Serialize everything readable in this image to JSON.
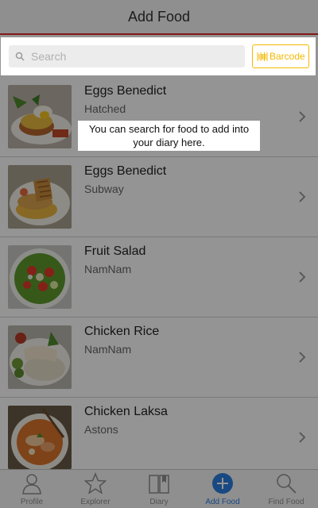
{
  "header": {
    "title": "Add Food"
  },
  "search": {
    "placeholder": "Search",
    "barcode_label": "Barcode"
  },
  "tooltip": {
    "line1": "You can search for food to add into",
    "line2": "your diary here."
  },
  "foods": [
    {
      "name": "Eggs Benedict",
      "place": "Hatched",
      "icon": "eggs-benedict-photo"
    },
    {
      "name": "Eggs Benedict",
      "place": "Subway",
      "icon": "eggs-benedict-sandwich-photo"
    },
    {
      "name": "Fruit Salad",
      "place": "NamNam",
      "icon": "fruit-salad-photo"
    },
    {
      "name": "Chicken Rice",
      "place": "NamNam",
      "icon": "chicken-rice-photo"
    },
    {
      "name": "Chicken Laksa",
      "place": "Astons",
      "icon": "chicken-laksa-photo"
    }
  ],
  "tabs": [
    {
      "label": "Profile",
      "icon": "person-icon",
      "active": false
    },
    {
      "label": "Explorer",
      "icon": "star-icon",
      "active": false
    },
    {
      "label": "Diary",
      "icon": "book-icon",
      "active": false
    },
    {
      "label": "Add Food",
      "icon": "plus-circle-icon",
      "active": true
    },
    {
      "label": "Find Food",
      "icon": "magnifier-icon",
      "active": false
    }
  ],
  "colors": {
    "accent": "#2a7fe0",
    "header_rule": "#e02a2a",
    "barcode": "#f5b800"
  }
}
